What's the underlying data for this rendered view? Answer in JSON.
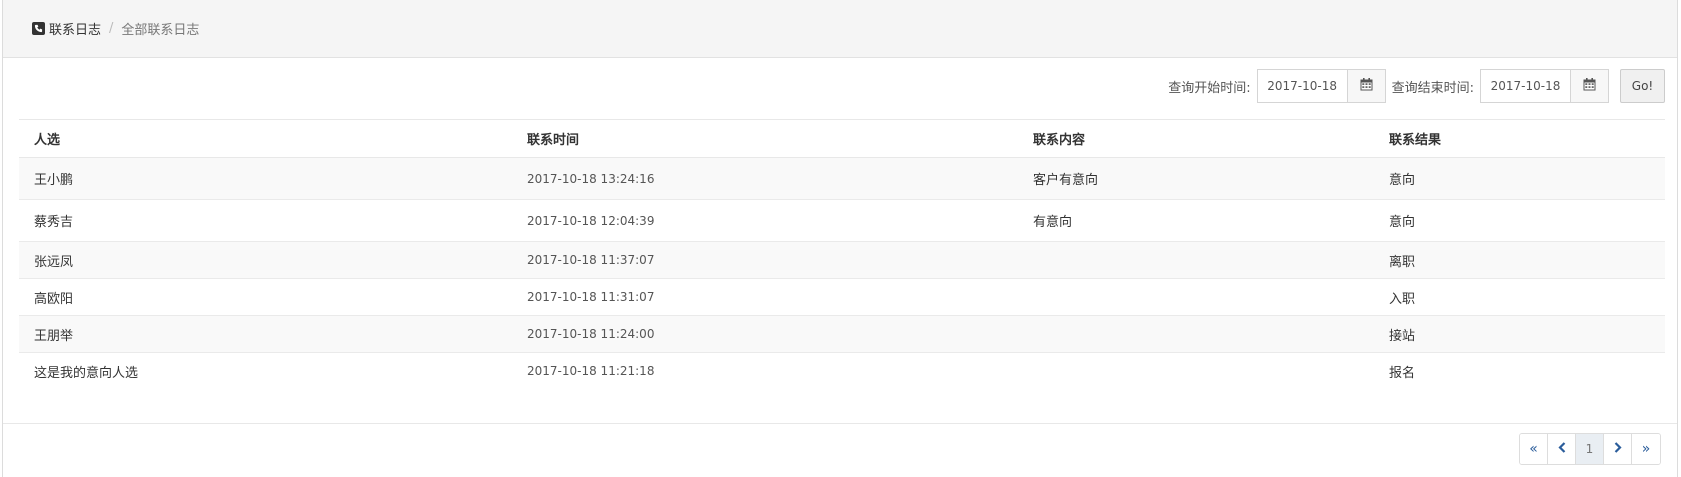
{
  "breadcrumb": {
    "home": "联系日志",
    "current": "全部联系日志",
    "separator": "/",
    "icon": "phone-square-icon"
  },
  "filters": {
    "start_label": "查询开始时间:",
    "start_value": "2017-10-18",
    "end_label": "查询结束时间:",
    "end_value": "2017-10-18",
    "go_label": "Go!",
    "calendar_icon": "calendar-icon"
  },
  "table": {
    "headers": [
      "人选",
      "联系时间",
      "联系内容",
      "联系结果"
    ],
    "rows": [
      {
        "name": "王小鹏",
        "time": "2017-10-18 13:24:16",
        "content": "客户有意向",
        "result": "意向"
      },
      {
        "name": "蔡秀吉",
        "time": "2017-10-18 12:04:39",
        "content": "有意向",
        "result": "意向"
      },
      {
        "name": "张远凤",
        "time": "2017-10-18 11:37:07",
        "content": "",
        "result": "离职"
      },
      {
        "name": "高欧阳",
        "time": "2017-10-18 11:31:07",
        "content": "",
        "result": "入职"
      },
      {
        "name": "王朋举",
        "time": "2017-10-18 11:24:00",
        "content": "",
        "result": "接站"
      },
      {
        "name": "这是我的意向人选",
        "time": "2017-10-18 11:21:18",
        "content": "",
        "result": "报名"
      }
    ]
  },
  "pagination": {
    "first": "«",
    "prev_icon": "chevron-left-icon",
    "current_page": "1",
    "next_icon": "chevron-right-icon",
    "last": "»"
  },
  "colors": {
    "accent_link": "#2b5d9b",
    "breadcrumb_bg": "#f5f5f5",
    "stripe_bg": "#f9f9f9"
  }
}
